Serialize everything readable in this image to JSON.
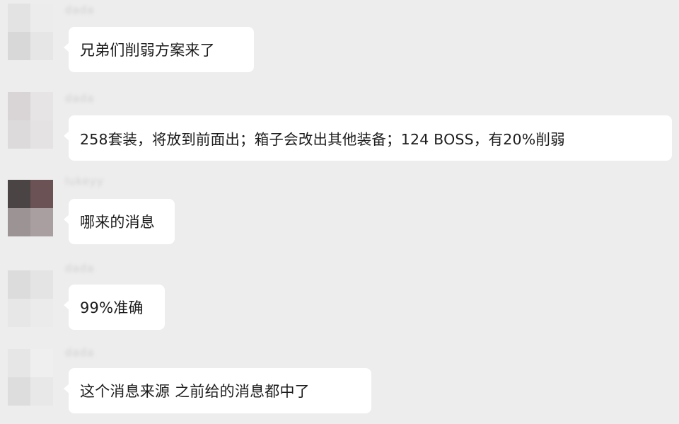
{
  "messages": [
    {
      "sender": "dada",
      "text": "兄弟们削弱方案来了",
      "avatar": [
        "#e3e3e3",
        "#ececec",
        "#d8d8d8",
        "#e6e6e6"
      ]
    },
    {
      "sender": "dada",
      "text": "258套装，将放到前面出；箱子会改出其他装备；124 BOSS，有20%削弱",
      "avatar": [
        "#d9d5d6",
        "#e6e4e4",
        "#dcdadb",
        "#e4e2e2"
      ]
    },
    {
      "sender": "lukeyy",
      "text": "哪来的消息",
      "avatar": [
        "#4a4445",
        "#6b5254",
        "#9b9394",
        "#a99fa0"
      ]
    },
    {
      "sender": "dada",
      "text": "99%准确",
      "avatar": [
        "#dcdcdc",
        "#e4e4e4",
        "#e7e7e7",
        "#ebebeb"
      ]
    },
    {
      "sender": "dada",
      "text": "这个消息来源  之前给的消息都中了",
      "avatar": [
        "#e6e6e6",
        "#efefef",
        "#dddddd",
        "#e8e8e8"
      ]
    }
  ]
}
